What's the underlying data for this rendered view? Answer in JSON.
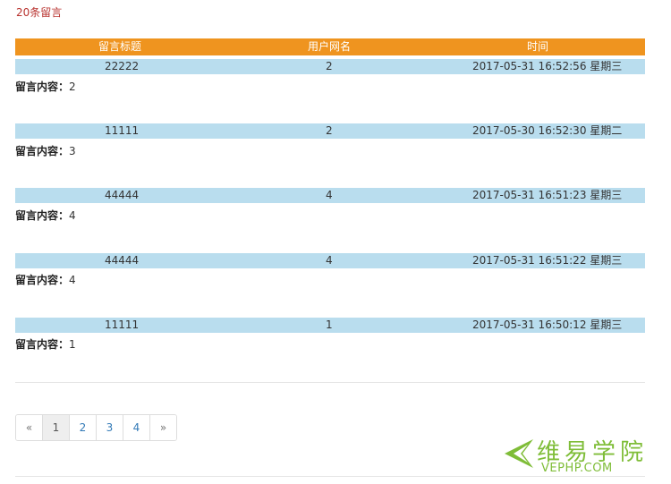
{
  "count_title": "20条留言",
  "table": {
    "headers": {
      "title": "留言标题",
      "user": "用户网名",
      "time": "时间"
    },
    "content_label": "留言内容：",
    "rows": [
      {
        "title": "22222",
        "user": "2",
        "time": "2017-05-31 16:52:56 星期三",
        "content": "2"
      },
      {
        "title": "11111",
        "user": "2",
        "time": "2017-05-30 16:52:30 星期二",
        "content": "3"
      },
      {
        "title": "44444",
        "user": "4",
        "time": "2017-05-31 16:51:23 星期三",
        "content": "4"
      },
      {
        "title": "44444",
        "user": "4",
        "time": "2017-05-31 16:51:22 星期三",
        "content": "4"
      },
      {
        "title": "11111",
        "user": "1",
        "time": "2017-05-31 16:50:12 星期三",
        "content": "1"
      }
    ]
  },
  "pagination": {
    "prev": "«",
    "pages": [
      "1",
      "2",
      "3",
      "4"
    ],
    "next": "»",
    "active_page": "1"
  },
  "watermark": {
    "cn": "维易学院",
    "en": "VEPHP.COM"
  }
}
